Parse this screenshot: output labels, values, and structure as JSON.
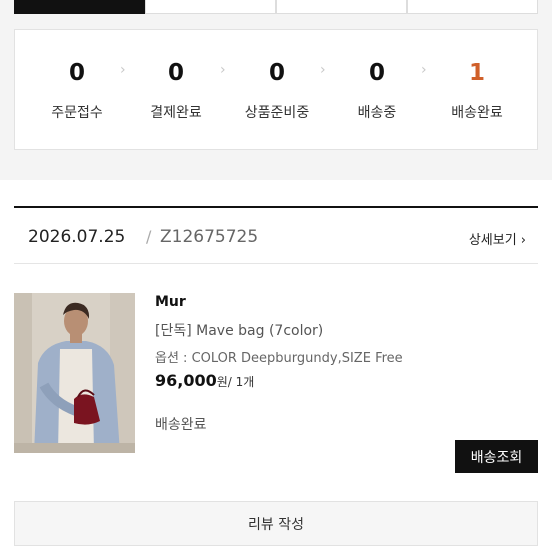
{
  "status_summary": {
    "items": [
      {
        "count": "0",
        "label": "주문접수"
      },
      {
        "count": "0",
        "label": "결제완료"
      },
      {
        "count": "0",
        "label": "상품준비중"
      },
      {
        "count": "0",
        "label": "배송중"
      },
      {
        "count": "1",
        "label": "배송완료"
      }
    ],
    "arrow_glyph": "›",
    "highlight_color": "#d0602a"
  },
  "order": {
    "date": "2026.07.25",
    "separator": "/",
    "order_number": "Z12675725",
    "detail_link": "상세보기 ›",
    "product": {
      "brand": "Mur",
      "name": "[단독] Mave bag (7color)",
      "option": "옵션 : COLOR Deepburgundy,SIZE Free",
      "price": "96,000",
      "price_unit": "원/ 1개",
      "status": "배송완료"
    },
    "track_button": "배송조회",
    "review_button": "리뷰 작성"
  }
}
